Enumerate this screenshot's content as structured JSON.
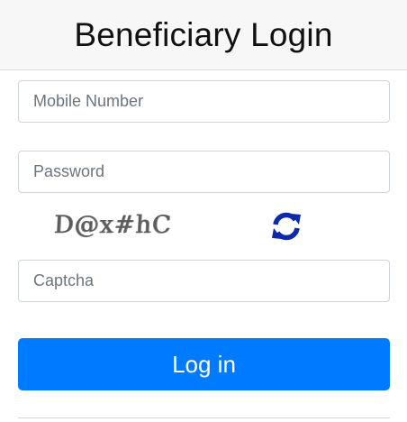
{
  "header": {
    "title": "Beneficiary Login"
  },
  "form": {
    "mobile_placeholder": "Mobile Number",
    "mobile_value": "",
    "password_placeholder": "Password",
    "password_value": "",
    "captcha_text": "D@x#hC",
    "captcha_refresh_icon": "refresh-icon",
    "captcha_placeholder": "Captcha",
    "captcha_value": "",
    "login_label": "Log in"
  },
  "colors": {
    "primary": "#007bff",
    "refresh_icon": "#0d2aa8",
    "header_bg": "#f7f7f7"
  }
}
